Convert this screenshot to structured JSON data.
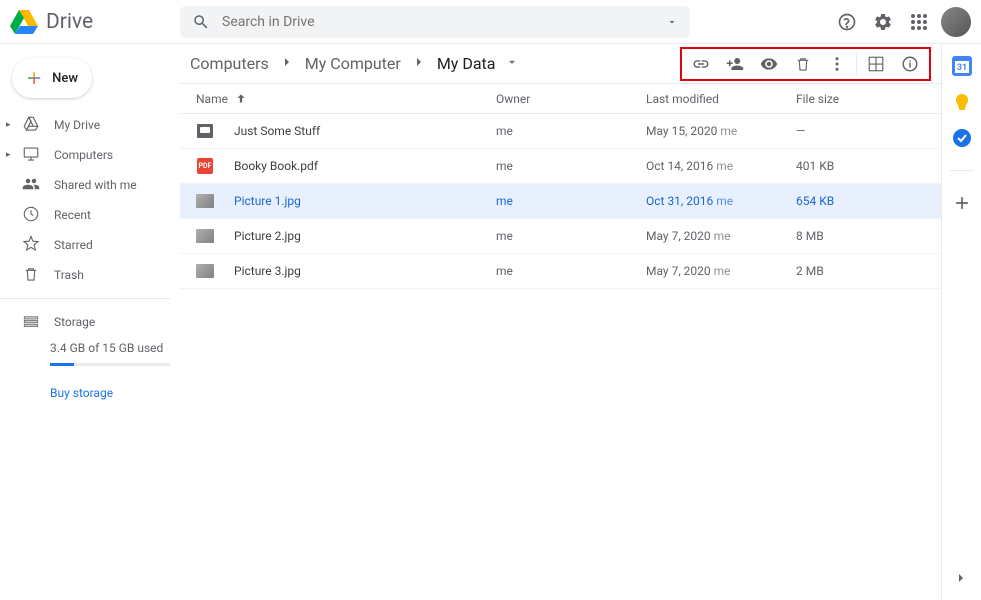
{
  "header": {
    "product": "Drive",
    "search_placeholder": "Search in Drive"
  },
  "sidebar": {
    "new_label": "New",
    "items": [
      {
        "label": "My Drive",
        "icon": "drive"
      },
      {
        "label": "Computers",
        "icon": "computer"
      },
      {
        "label": "Shared with me",
        "icon": "people"
      },
      {
        "label": "Recent",
        "icon": "clock"
      },
      {
        "label": "Starred",
        "icon": "star"
      },
      {
        "label": "Trash",
        "icon": "trash"
      }
    ],
    "storage_label": "Storage",
    "storage_used": "3.4 GB of 15 GB used",
    "buy_label": "Buy storage"
  },
  "breadcrumbs": [
    "Computers",
    "My Computer",
    "My Data"
  ],
  "columns": {
    "name": "Name",
    "owner": "Owner",
    "modified": "Last modified",
    "size": "File size"
  },
  "files": [
    {
      "name": "Just Some Stuff",
      "owner": "me",
      "modified": "May 15, 2020",
      "mod_by": "me",
      "size": "—",
      "type": "folder",
      "selected": false
    },
    {
      "name": "Booky Book.pdf",
      "owner": "me",
      "modified": "Oct 14, 2016",
      "mod_by": "me",
      "size": "401 KB",
      "type": "pdf",
      "selected": false
    },
    {
      "name": "Picture 1.jpg",
      "owner": "me",
      "modified": "Oct 31, 2016",
      "mod_by": "me",
      "size": "654 KB",
      "type": "image",
      "selected": true
    },
    {
      "name": "Picture 2.jpg",
      "owner": "me",
      "modified": "May 7, 2020",
      "mod_by": "me",
      "size": "8 MB",
      "type": "image",
      "selected": false
    },
    {
      "name": "Picture 3.jpg",
      "owner": "me",
      "modified": "May 7, 2020",
      "mod_by": "me",
      "size": "2 MB",
      "type": "image",
      "selected": false
    }
  ]
}
